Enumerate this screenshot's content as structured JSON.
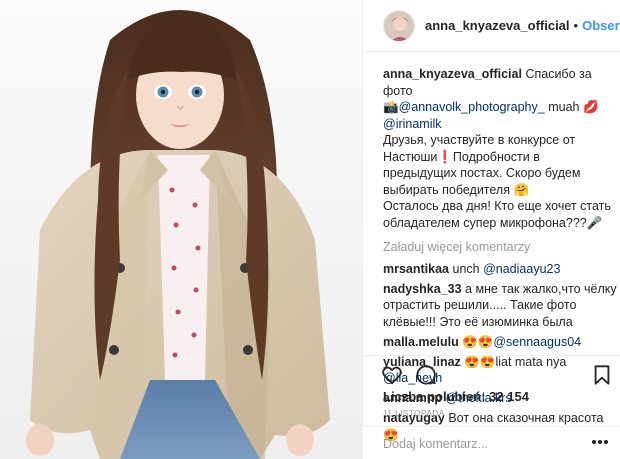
{
  "header": {
    "username": "anna_knyazeva_official",
    "separator": "•",
    "follow_label": "Obserwuj"
  },
  "caption": {
    "username": "anna_knyazeva_official",
    "line1": "Спасибо за фото",
    "camera_emoji": "📸",
    "mention1": "@annavolk_photography_",
    "muah": "muah",
    "kiss_emoji": "💋",
    "mention2": "@irinamilk",
    "text2": "Друзья, участвуйте в конкурсе от Настюши",
    "excl": "❗",
    "text3": "Подробности в предыдущих постах. Скоро будем выбирать победителя",
    "hug_emoji": "🤗",
    "text4": "Осталось два дня! Кто еще хочет стать обладателем супер микрофона???",
    "mic_emoji": "🎤"
  },
  "load_more": "Załaduj więcej komentarzy",
  "comments": [
    {
      "user": "mrsantikaa",
      "text": "unch",
      "mention": "@nadiaayu23"
    },
    {
      "user": "nadyshka_33",
      "text": "а мне так жалко,что чёлку отрастить решили..... Такие фото клёвые!!! Это её изюминка была"
    },
    {
      "user": "malla.melulu",
      "emoji": "😍😍",
      "mention": "@sennaagus04"
    },
    {
      "user": "yuliana_linaz",
      "emoji": "😍😍",
      "text": "liat mata nya",
      "mention": "@lia_neyh"
    },
    {
      "user": "anna.mnp",
      "mention": "@thekla.krs"
    },
    {
      "user": "natayugay",
      "text": "Вот она сказочная красота",
      "emoji": "😍"
    }
  ],
  "likes": "Liczba polubień: 32 154",
  "date": "11 LISTOPADA",
  "add_comment_placeholder": "Dodaj komentarz...",
  "icons": [
    "heart-icon",
    "comment-icon",
    "bookmark-icon",
    "more-options-icon"
  ]
}
